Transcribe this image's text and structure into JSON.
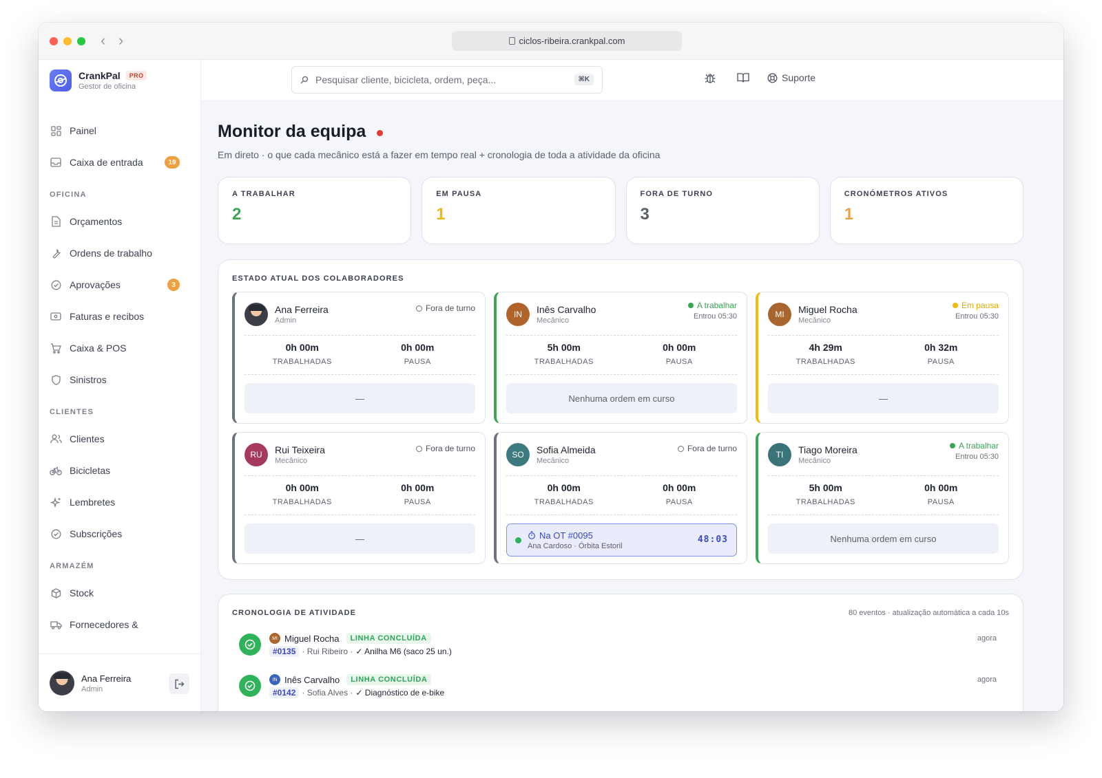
{
  "browser": {
    "url": "ciclos-ribeira.crankpal.com"
  },
  "brand": {
    "name": "CrankPal",
    "tier": "PRO",
    "subtitle": "Gestor de oficina"
  },
  "nav": {
    "painel": "Painel",
    "inbox": {
      "label": "Caixa de entrada",
      "badge": "19"
    },
    "section_oficina": "OFICINA",
    "orcamentos": "Orçamentos",
    "ordens": "Ordens de trabalho",
    "aprovacoes": {
      "label": "Aprovações",
      "badge": "3"
    },
    "faturas": "Faturas e recibos",
    "caixa": "Caixa & POS",
    "sinistros": "Sinistros",
    "section_clientes": "CLIENTES",
    "clientes": "Clientes",
    "bicicletas": "Bicicletas",
    "lembretes": "Lembretes",
    "subscricoes": "Subscrições",
    "section_armazem": "ARMAZÉM",
    "stock": "Stock",
    "fornecedores": "Fornecedores &"
  },
  "current_user": {
    "name": "Ana Ferreira",
    "role": "Admin"
  },
  "search": {
    "placeholder": "Pesquisar cliente, bicicleta, ordem, peça...",
    "shortcut": "⌘K"
  },
  "header": {
    "support_label": "Suporte"
  },
  "page": {
    "title": "Monitor da equipa",
    "subtitle": "Em direto · o que cada mecânico está a fazer em tempo real + cronologia de toda a atividade da oficina"
  },
  "stats": [
    {
      "label": "A TRABALHAR",
      "value": "2",
      "color": "#3aa655"
    },
    {
      "label": "EM PAUSA",
      "value": "1",
      "color": "#f2b90c"
    },
    {
      "label": "FORA DE TURNO",
      "value": "3",
      "color": "#5b5f6b"
    },
    {
      "label": "CRONÓMETROS ATIVOS",
      "value": "1",
      "color": "#f0a040"
    }
  ],
  "team": {
    "title": "ESTADO ATUAL DOS COLABORADORES",
    "worked_label": "TRABALHADAS",
    "pause_label": "PAUSA",
    "members": [
      {
        "name": "Ana Ferreira",
        "role": "Admin",
        "initials": "",
        "status": "Fora de turno",
        "since": "",
        "worked": "0h 00m",
        "pause": "0h 00m",
        "activity": "—"
      },
      {
        "name": "Inês Carvalho",
        "role": "Mecânico",
        "initials": "IN",
        "status": "A trabalhar",
        "since": "Entrou 05:30",
        "worked": "5h 00m",
        "pause": "0h 00m",
        "activity": "Nenhuma ordem em curso"
      },
      {
        "name": "Miguel Rocha",
        "role": "Mecânico",
        "initials": "MI",
        "status": "Em pausa",
        "since": "Entrou 05:30",
        "worked": "4h 29m",
        "pause": "0h 32m",
        "activity": "—"
      },
      {
        "name": "Rui Teixeira",
        "role": "Mecânico",
        "initials": "RU",
        "status": "Fora de turno",
        "since": "",
        "worked": "0h 00m",
        "pause": "0h 00m",
        "activity": "—"
      },
      {
        "name": "Sofia Almeida",
        "role": "Mecânico",
        "initials": "SO",
        "status": "Fora de turno",
        "since": "",
        "worked": "0h 00m",
        "pause": "0h 00m",
        "activity": "",
        "active_order": {
          "title": "Na OT #0095",
          "detail": "Ana Cardoso · Órbita Estoril",
          "timer": "48:03"
        }
      },
      {
        "name": "Tiago Moreira",
        "role": "Mecânico",
        "initials": "TI",
        "status": "A trabalhar",
        "since": "Entrou 05:30",
        "worked": "5h 00m",
        "pause": "0h 00m",
        "activity": "Nenhuma ordem em curso"
      }
    ]
  },
  "timeline": {
    "title": "CRONOLOGIA DE ATIVIDADE",
    "meta": "80 eventos · atualização automática a cada 10s",
    "events": [
      {
        "initials": "MI",
        "user": "Miguel Rocha",
        "tag": "LINHA CONCLUÍDA",
        "order": "#0135",
        "client": "· Rui Ribeiro ·",
        "line": "✓ Anilha M6 (saco 25 un.)",
        "time": "agora"
      },
      {
        "initials": "IN",
        "user": "Inês Carvalho",
        "tag": "LINHA CONCLUÍDA",
        "order": "#0142",
        "client": "· Sofia Alves ·",
        "line": "✓ Diagnóstico de e-bike",
        "time": "agora"
      }
    ]
  },
  "colors": {
    "accent": "#4d5ee8",
    "working": "#3aa655",
    "paused": "#f2b90c",
    "off": "#6b7280",
    "avatar_in": "#b0642a",
    "avatar_mi": "#a8652d",
    "avatar_ru": "#a63a5c",
    "avatar_so": "#3c7a80",
    "avatar_ti": "#3a7478"
  }
}
